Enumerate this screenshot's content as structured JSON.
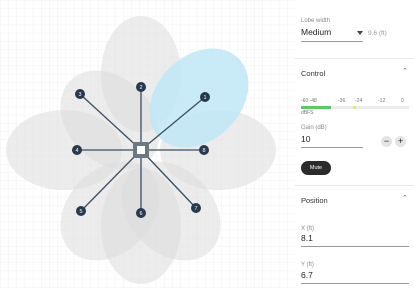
{
  "panel": {
    "lobe_width": {
      "label": "Lobe width",
      "value": "Medium",
      "dropdown_icon": "caret-down-icon",
      "hint": "9.6 (ft)"
    },
    "control": {
      "title": "Control",
      "collapse_icon": "chevron-up-icon",
      "meter_scale": [
        "-60 -48",
        "-36",
        "-24",
        "-12",
        "0"
      ],
      "meter_unit": "dBFS",
      "meter_colors": [
        "#5cc76b",
        "#e8e56a"
      ],
      "gain": {
        "label": "Gain (dB)",
        "value": "10",
        "minus": "−",
        "plus": "+"
      },
      "mute_label": "Mute"
    },
    "position": {
      "title": "Position",
      "collapse_icon": "chevron-up-icon",
      "x": {
        "label": "X (ft)",
        "value": "8.1"
      },
      "y": {
        "label": "Y (ft)",
        "value": "6.7"
      }
    }
  },
  "array": {
    "lobes": [
      "1",
      "2",
      "3",
      "4",
      "5",
      "6",
      "7",
      "8"
    ],
    "selected_lobe": "1",
    "colors": {
      "lobe": "#dcdcdc",
      "selected_lobe": "#bfe8f7",
      "line": "#3c4e60",
      "node": "#26394d"
    }
  }
}
